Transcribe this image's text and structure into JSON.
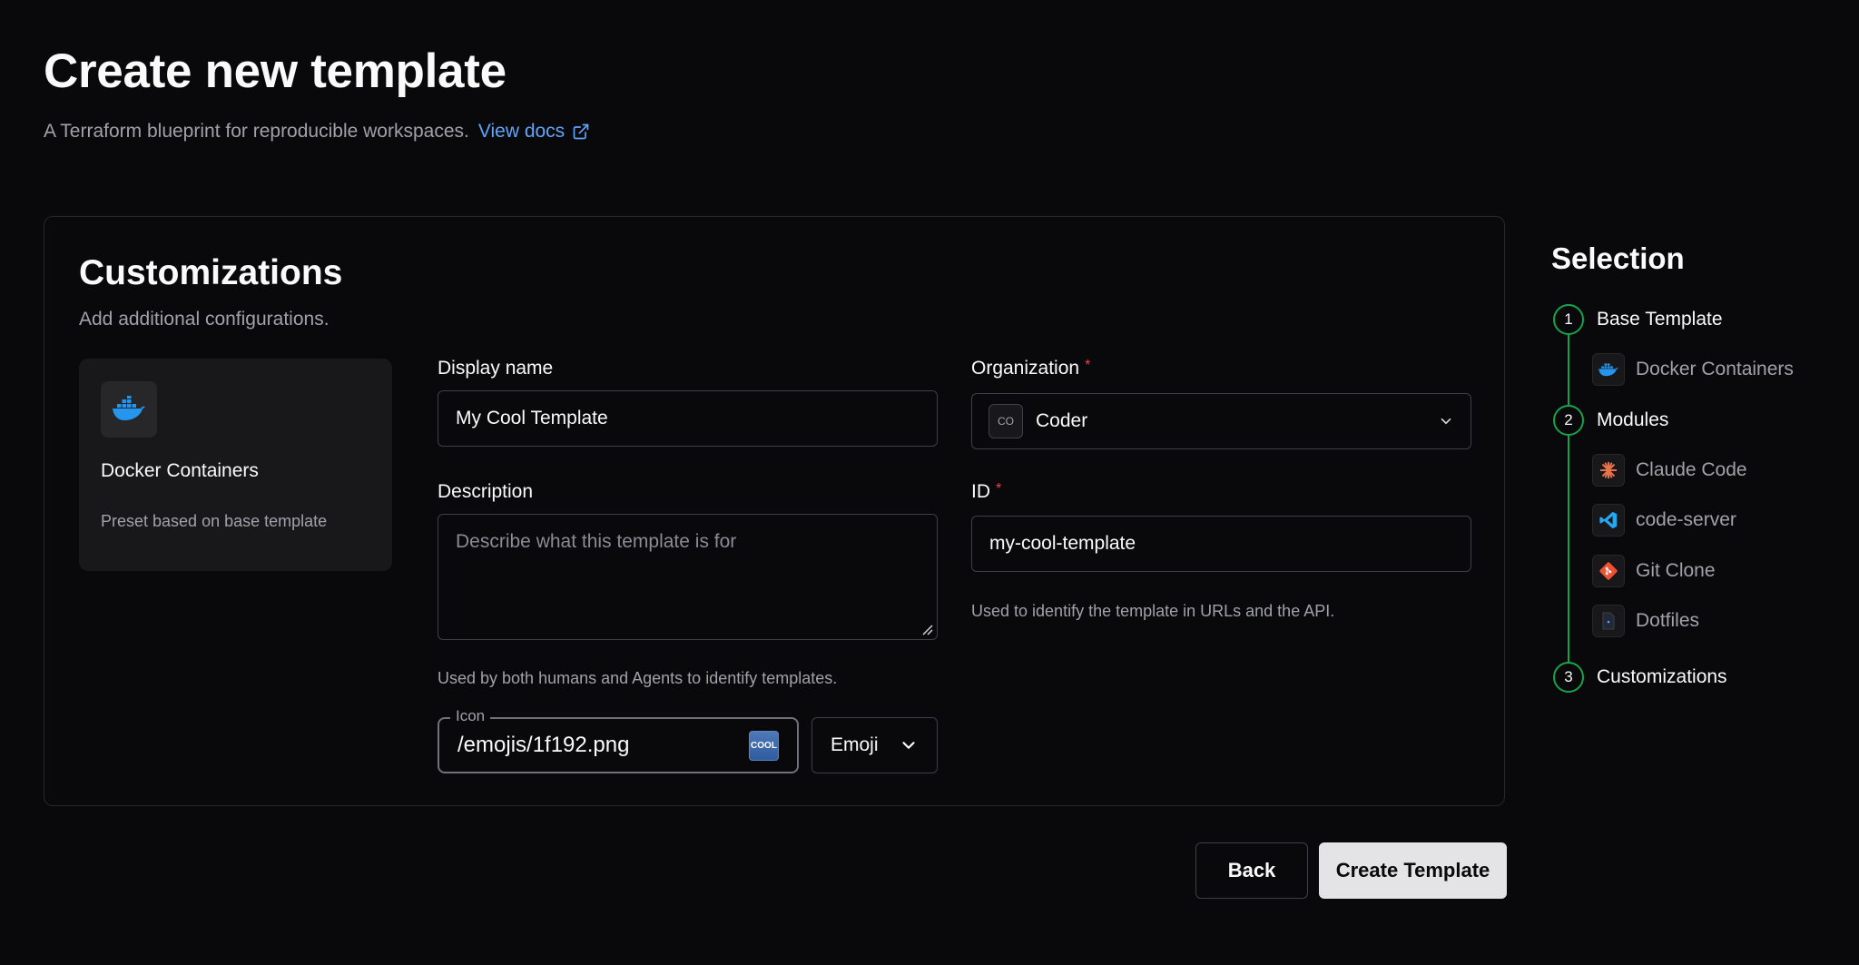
{
  "header": {
    "title": "Create new template",
    "subtitle": "A Terraform blueprint for reproducible workspaces.",
    "docs_link": "View docs"
  },
  "card": {
    "title": "Customizations",
    "description": "Add additional configurations.",
    "preset": {
      "name": "Docker Containers",
      "note": "Preset based on base template"
    }
  },
  "form": {
    "display_name": {
      "label": "Display name",
      "value": "My Cool Template"
    },
    "organization": {
      "label": "Organization",
      "required_mark": "*",
      "badge": "CO",
      "value": "Coder"
    },
    "description": {
      "label": "Description",
      "placeholder": "Describe what this template is for",
      "help": "Used by both humans and Agents to identify templates."
    },
    "id": {
      "label": "ID",
      "required_mark": "*",
      "value": "my-cool-template",
      "help": "Used to identify the template in URLs and the API."
    },
    "icon": {
      "legend": "Icon",
      "value": "/emojis/1f192.png",
      "preview": "COOL",
      "type_label": "Emoji"
    }
  },
  "actions": {
    "back": "Back",
    "create": "Create Template"
  },
  "selection": {
    "title": "Selection",
    "steps": [
      {
        "number": "1",
        "label": "Base Template"
      },
      {
        "number": "2",
        "label": "Modules"
      },
      {
        "number": "3",
        "label": "Customizations"
      }
    ],
    "base_template": {
      "label": "Docker Containers",
      "icon": "docker-icon"
    },
    "modules": [
      {
        "label": "Claude Code",
        "icon": "claude-icon"
      },
      {
        "label": "code-server",
        "icon": "vscode-icon"
      },
      {
        "label": "Git Clone",
        "icon": "git-icon"
      },
      {
        "label": "Dotfiles",
        "icon": "file-icon"
      }
    ]
  },
  "colors": {
    "background": "#09090b",
    "accent_link": "#60a5fa",
    "step_green": "#16a34a",
    "required": "#ef4444",
    "primary_button": "#e4e4e7"
  }
}
